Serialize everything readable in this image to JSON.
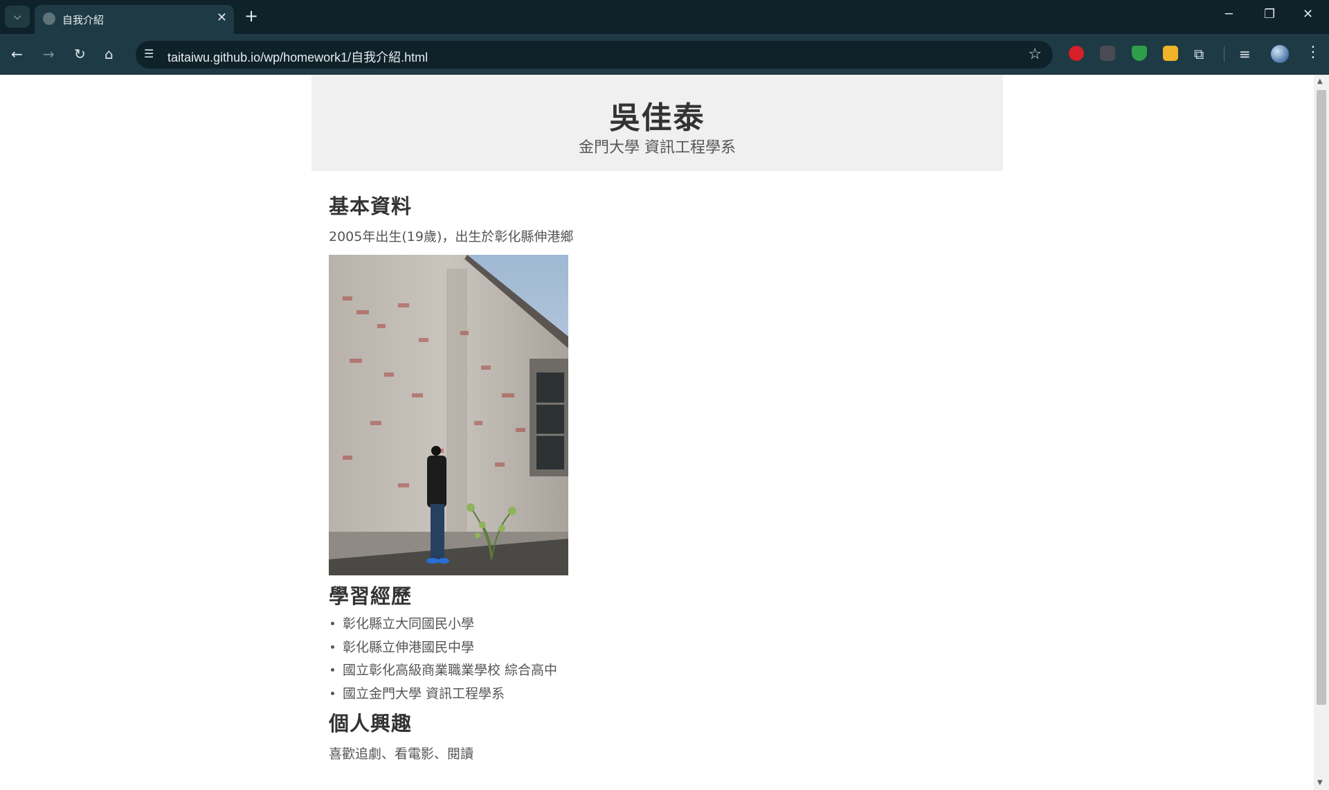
{
  "browser": {
    "tab_title": "自我介紹",
    "url": "taitaiwu.github.io/wp/homework1/自我介紹.html"
  },
  "page": {
    "name": "吳佳泰",
    "subtitle": "金門大學 資訊工程學系",
    "basic_title": "基本資料",
    "basic_text": "2005年出生(19歲)，出生於彰化縣伸港鄉",
    "education_title": "學習經歷",
    "education": [
      "彰化縣立大同國民小學",
      "彰化縣立伸港國民中學",
      "國立彰化高級商業職業學校 綜合高中",
      "國立金門大學 資訊工程學系"
    ],
    "interests_title": "個人興趣",
    "interests_text": "喜歡追劇、看電影、閱讀"
  },
  "colors": {
    "tabbar": "#0f2129",
    "toolbar": "#1e3a45",
    "header_bg": "#f0f0f0",
    "heading_text": "#333333",
    "body_text": "#555555"
  }
}
